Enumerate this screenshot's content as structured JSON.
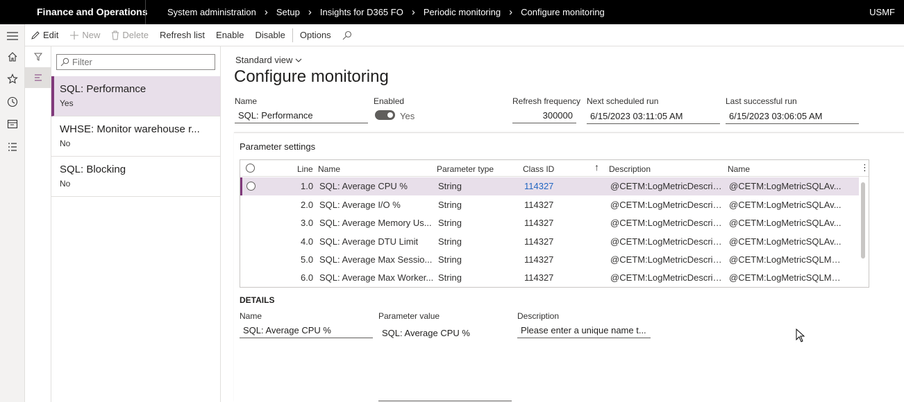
{
  "topbar": {
    "app_title": "Finance and Operations",
    "breadcrumb": [
      "System administration",
      "Setup",
      "Insights for D365 FO",
      "Periodic monitoring",
      "Configure monitoring"
    ],
    "company": "USMF"
  },
  "actions": {
    "edit": "Edit",
    "new": "New",
    "delete": "Delete",
    "refresh": "Refresh list",
    "enable": "Enable",
    "disable": "Disable",
    "options": "Options"
  },
  "list": {
    "filter_placeholder": "Filter",
    "items": [
      {
        "title": "SQL: Performance",
        "status": "Yes"
      },
      {
        "title": "WHSE:  Monitor warehouse r...",
        "status": "No"
      },
      {
        "title": "SQL: Blocking",
        "status": "No"
      }
    ]
  },
  "header": {
    "view": "Standard view",
    "title": "Configure monitoring",
    "name_label": "Name",
    "name_value": "SQL: Performance",
    "enabled_label": "Enabled",
    "enabled_value": "Yes",
    "refresh_label": "Refresh frequency",
    "refresh_value": "300000",
    "next_label": "Next scheduled run",
    "next_value": "6/15/2023 03:11:05 AM",
    "last_label": "Last successful run",
    "last_value": "6/15/2023 03:06:05 AM"
  },
  "params": {
    "section_title": "Parameter settings",
    "columns": {
      "line": "Line",
      "name": "Name",
      "type": "Parameter type",
      "classid": "Class ID",
      "description": "Description",
      "name2": "Name"
    },
    "rows": [
      {
        "line": "1.0",
        "name": "SQL: Average CPU %",
        "type": "String",
        "classid": "114327",
        "description": "@CETM:LogMetricDescrip...",
        "name2": "@CETM:LogMetricSQLAv..."
      },
      {
        "line": "2.0",
        "name": "SQL: Average I/O %",
        "type": "String",
        "classid": "114327",
        "description": "@CETM:LogMetricDescrip...",
        "name2": "@CETM:LogMetricSQLAv..."
      },
      {
        "line": "3.0",
        "name": "SQL: Average Memory Us...",
        "type": "String",
        "classid": "114327",
        "description": "@CETM:LogMetricDescrip...",
        "name2": "@CETM:LogMetricSQLAv..."
      },
      {
        "line": "4.0",
        "name": "SQL: Average DTU Limit",
        "type": "String",
        "classid": "114327",
        "description": "@CETM:LogMetricDescrip...",
        "name2": "@CETM:LogMetricSQLAv..."
      },
      {
        "line": "5.0",
        "name": "SQL: Average Max Sessio...",
        "type": "String",
        "classid": "114327",
        "description": "@CETM:LogMetricDescrip...",
        "name2": "@CETM:LogMetricSQLMa..."
      },
      {
        "line": "6.0",
        "name": "SQL: Average Max Worker...",
        "type": "String",
        "classid": "114327",
        "description": "@CETM:LogMetricDescrip...",
        "name2": "@CETM:LogMetricSQLMa..."
      }
    ]
  },
  "details": {
    "title": "DETAILS",
    "name_label": "Name",
    "name_value": "SQL: Average CPU %",
    "value_label": "Parameter value",
    "value_value": "SQL: Average CPU %",
    "desc_label": "Description",
    "desc_value": "Please enter a unique name t..."
  },
  "colors": {
    "accent": "#80397b",
    "selected_bg": "#e8dfea",
    "link": "#2266c2"
  }
}
